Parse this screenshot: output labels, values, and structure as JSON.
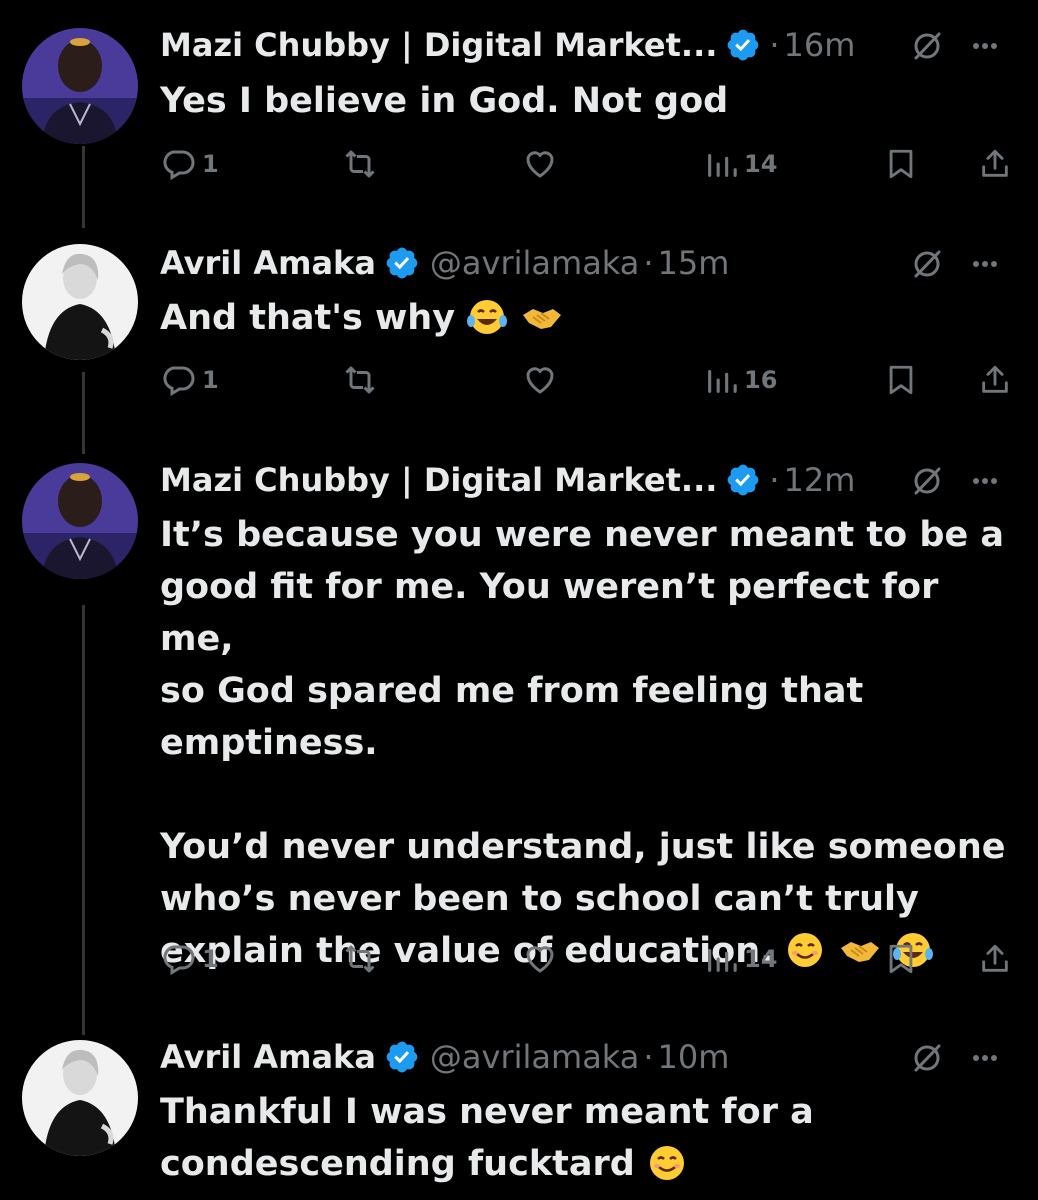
{
  "tweets": [
    {
      "author": "Mazi Chubby | Digital Market...",
      "handle": "",
      "dot": "·",
      "time": "16m",
      "text": "Yes I believe in God. Not god",
      "replies": "1",
      "retweets": "",
      "likes": "",
      "views": "14",
      "avatar": "man-purple",
      "emojis": []
    },
    {
      "author": "Avril Amaka",
      "handle": "@avrilamaka",
      "dot": "·",
      "time": "15m",
      "text": "And that's why",
      "replies": "1",
      "retweets": "",
      "likes": "",
      "views": "16",
      "avatar": "woman-bw",
      "emojis": [
        "tears-of-joy",
        "handshake"
      ]
    },
    {
      "author": "Mazi Chubby | Digital Market...",
      "handle": "",
      "dot": "·",
      "time": "12m",
      "text": "It’s because you were never meant to be a\ngood fit for me. You weren’t perfect for me,\nso God spared me from feeling that\nemptiness.\n\nYou’d never understand, just like someone\nwho’s never been to school can’t truly\nexplain the value of education.",
      "replies": "1",
      "retweets": "",
      "likes": "",
      "views": "14",
      "avatar": "man-purple",
      "emojis": [
        "smiling",
        "handshake",
        "tears-of-joy"
      ]
    },
    {
      "author": "Avril Amaka",
      "handle": "@avrilamaka",
      "dot": "·",
      "time": "10m",
      "text": "Thankful I was never meant for a\ncondescending fucktard",
      "replies": "",
      "retweets": "",
      "likes": "",
      "views": "",
      "avatar": "woman-bw",
      "emojis": [
        "smiling"
      ]
    }
  ],
  "icons": {
    "verified": "verified-badge-icon",
    "grok": "grok-icon",
    "more": "more-icon",
    "reply": "reply-icon",
    "retweet": "retweet-icon",
    "like": "like-icon",
    "views": "views-icon",
    "bookmark": "bookmark-icon",
    "share": "share-icon"
  },
  "colors": {
    "background": "#000000",
    "text": "#e7e9ea",
    "muted": "#71767b",
    "verified": "#1d9bf0",
    "thread_line": "#333639"
  }
}
